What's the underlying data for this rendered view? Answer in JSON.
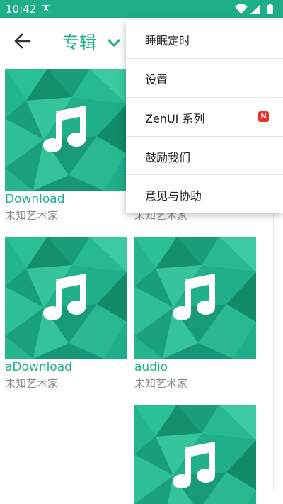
{
  "status_bar": {
    "time": "10:42",
    "notification": "A"
  },
  "app_bar": {
    "title": "专辑"
  },
  "albums": [
    {
      "name": "Download",
      "artist": "未知艺术家"
    },
    {
      "name": "",
      "artist": "未知艺术家"
    },
    {
      "name": "aDownload",
      "artist": "未知艺术家"
    },
    {
      "name": "audio",
      "artist": "未知艺术家"
    },
    {
      "name": "",
      "artist": ""
    }
  ],
  "menu": {
    "items": [
      {
        "label": "睡眠定时"
      },
      {
        "label": "设置"
      },
      {
        "label": "ZenUI 系列",
        "badge": "N"
      },
      {
        "label": "鼓励我们"
      },
      {
        "label": "意见与协助"
      }
    ]
  },
  "colors": {
    "accent": "#1fae8a",
    "badge": "#e8332a",
    "artist_text": "#8a8a8a"
  },
  "icons": {
    "back": "arrow-left-icon",
    "dropdown": "chevron-down-icon",
    "album_art": "music-note-icon"
  }
}
